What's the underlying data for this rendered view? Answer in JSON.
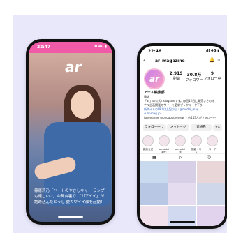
{
  "phone_left": {
    "status_time": "22:47",
    "status_indicators": "ıll 4G ▮",
    "logo": "ar",
    "caption": "篠原莉乃「ハートのやさしキャー ランプも楽しい♡」の舞台裏で 「ガアイイ」が詰め込んだとっし 愛カワイイ顔を起動！"
  },
  "phone_right": {
    "status_time": "22:46",
    "status_indicators": "ıll 4G ▮",
    "username": "ar_magazine",
    "avatar_logo": "ar",
    "stats": [
      {
        "value": "2,919",
        "label": "投稿"
      },
      {
        "value": "30.8万",
        "label": "フォロワー"
      },
      {
        "value": "9",
        "label": "フォロー中"
      }
    ],
    "bio_name": "アール編集部",
    "bio_lines": [
      "雑誌",
      "「ar」の公式Instagramです。毎回12日に発売ささのオ",
      "ナル企画掲載のサイトを更新ブックマーク下り",
      "新サイトのURLは上記から♩ @model_mag",
      "⊕ ar-mag.jp"
    ],
    "followed_by": "takemame_monogoodreview と他143人がフォロー中",
    "buttons": [
      "フォロー中 ⌄",
      "メッセージ",
      "連絡先",
      "+∧"
    ],
    "highlights": [
      "雑誌公式",
      "armodel新作",
      "armodel 発",
      "撮影・コメ",
      "コーデ"
    ],
    "grid_colors": [
      "#c9d9ee",
      "#d7cfe6",
      "#e8d6d9",
      "#b7c7e4",
      "#e6dcef",
      "#cfd8ea",
      "#f0e1ea",
      "#d1d9f0",
      "#e1d3ee"
    ]
  }
}
